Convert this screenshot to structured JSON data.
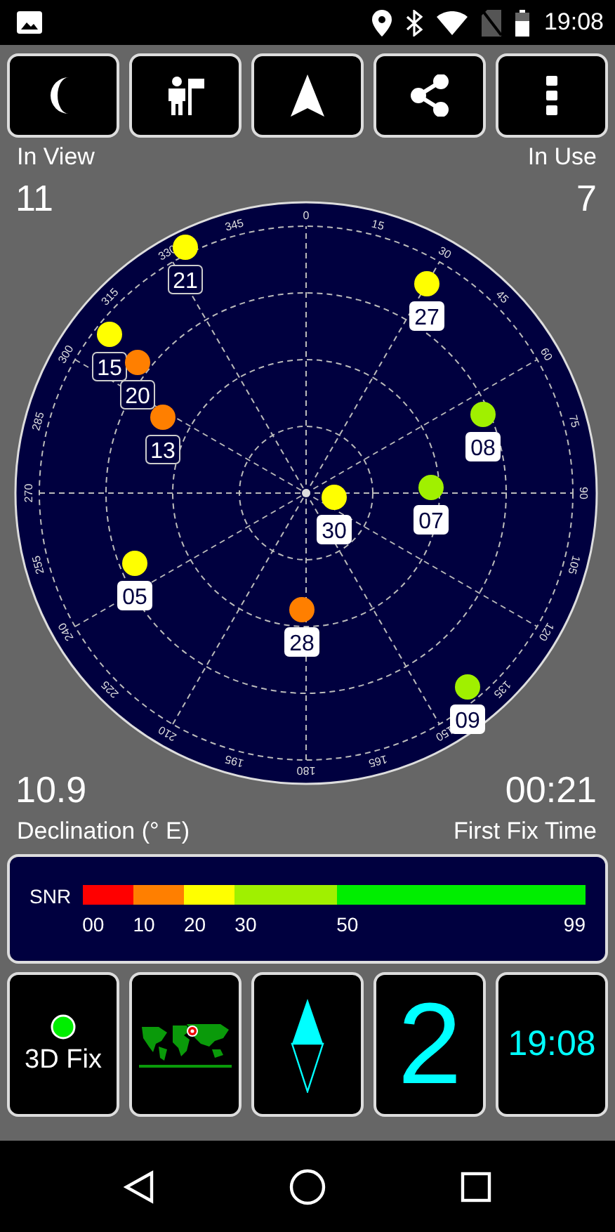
{
  "status_bar": {
    "time": "19:08"
  },
  "toolbar": {
    "buttons": [
      {
        "kind": "night"
      },
      {
        "kind": "guide"
      },
      {
        "kind": "navigate"
      },
      {
        "kind": "share"
      },
      {
        "kind": "more"
      }
    ]
  },
  "in_view": {
    "label": "In View",
    "value": "11"
  },
  "in_use": {
    "label": "In Use",
    "value": "7"
  },
  "sky_plot": {
    "azimuth_labels": [
      "0",
      "15",
      "30",
      "45",
      "60",
      "75",
      "90",
      "105",
      "120",
      "135",
      "150",
      "165",
      "180",
      "195",
      "210",
      "225",
      "240",
      "255",
      "270",
      "285",
      "300",
      "315",
      "330",
      "345"
    ],
    "satellites": [
      {
        "id": "21",
        "color": "#ffff00",
        "used": false
      },
      {
        "id": "27",
        "color": "#ffff00",
        "used": true
      },
      {
        "id": "15",
        "color": "#ffff00",
        "used": false
      },
      {
        "id": "20",
        "color": "#ff7f00",
        "used": false
      },
      {
        "id": "13",
        "color": "#ff7f00",
        "used": false
      },
      {
        "id": "08",
        "color": "#a0f000",
        "used": true
      },
      {
        "id": "30",
        "color": "#ffff00",
        "used": true
      },
      {
        "id": "07",
        "color": "#a0f000",
        "used": true
      },
      {
        "id": "05",
        "color": "#ffff00",
        "used": true
      },
      {
        "id": "28",
        "color": "#ff7f00",
        "used": true
      },
      {
        "id": "09",
        "color": "#a0f000",
        "used": true
      }
    ]
  },
  "declination": {
    "value": "10.9",
    "label": "Declination (° E)"
  },
  "first_fix": {
    "value": "00:21",
    "label": "First Fix Time"
  },
  "snr_legend": {
    "title": "SNR",
    "segments": [
      {
        "label": "00",
        "color": "#ff0000"
      },
      {
        "label": "10",
        "color": "#ff7f00"
      },
      {
        "label": "20",
        "color": "#ffff00"
      },
      {
        "label": "30",
        "color": "#a0f000"
      },
      {
        "label": "50",
        "color": "#00ee00"
      }
    ],
    "end_label": "99"
  },
  "tiles": [
    {
      "kind": "fix",
      "label": "3D Fix",
      "color": "#00ee00"
    },
    {
      "kind": "map"
    },
    {
      "kind": "compass"
    },
    {
      "kind": "number",
      "value": "2"
    },
    {
      "kind": "clock",
      "value": "19:08"
    }
  ]
}
